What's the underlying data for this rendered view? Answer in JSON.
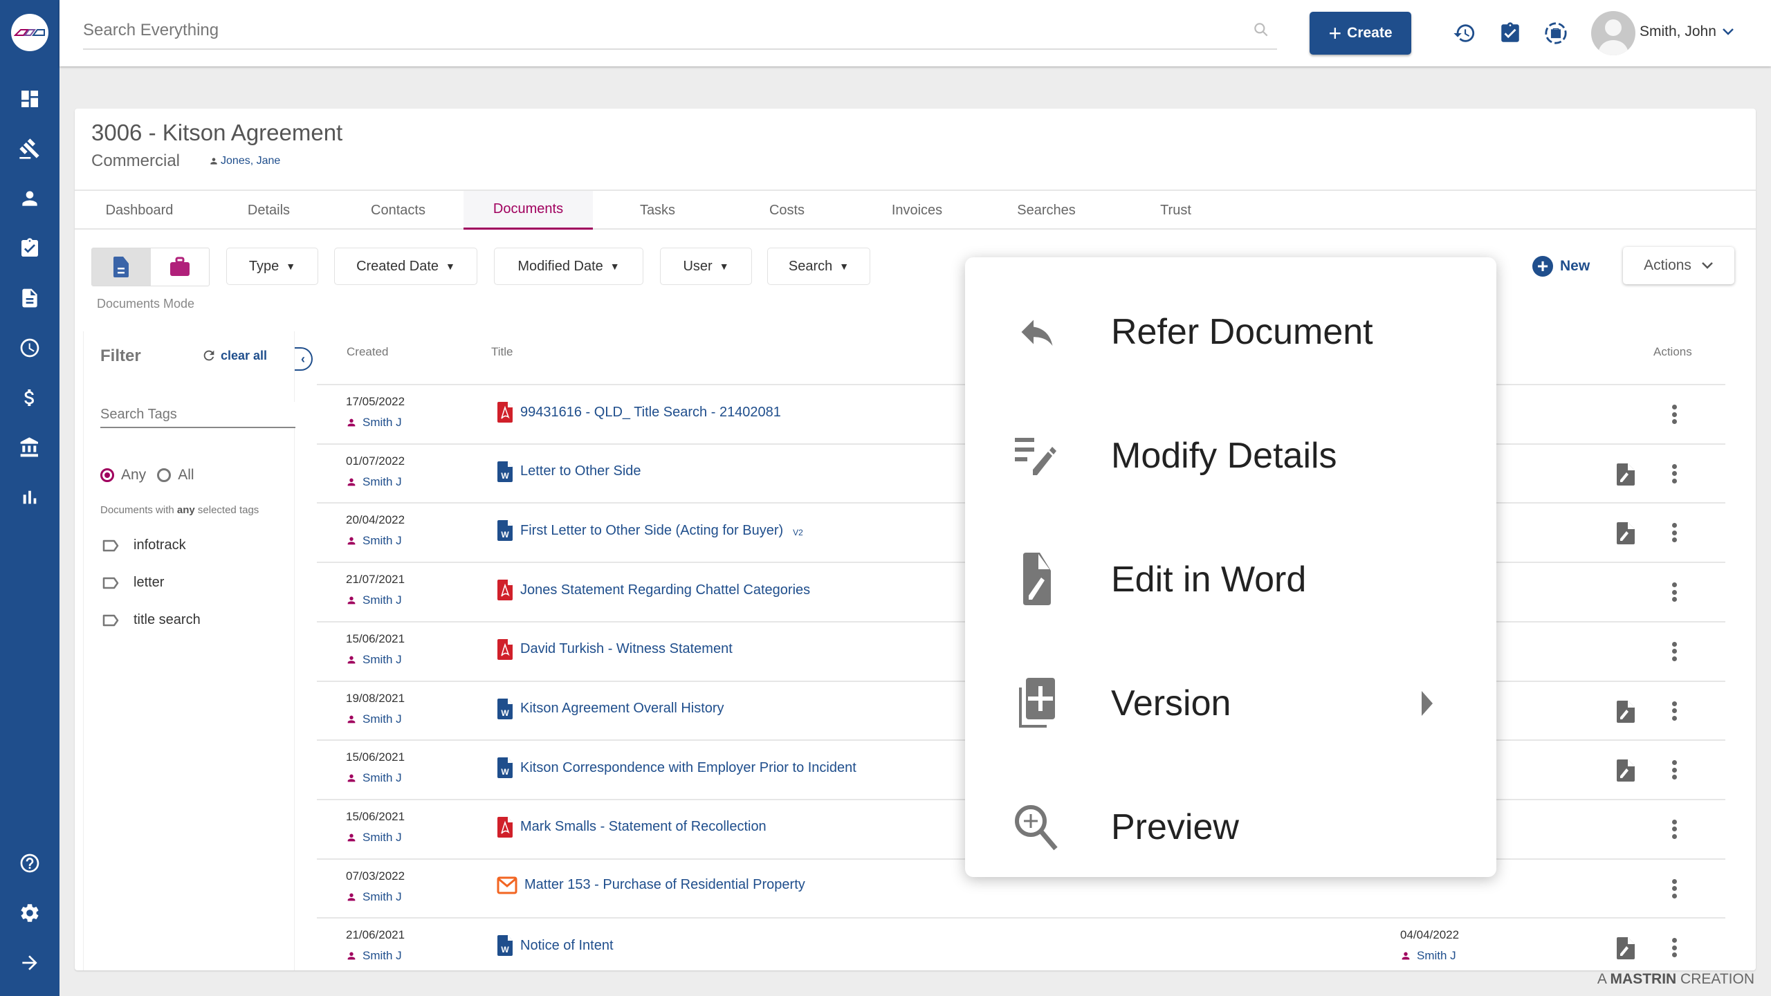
{
  "header": {
    "search_placeholder": "Search Everything",
    "create_label": "Create",
    "user_name": "Smith, John"
  },
  "sidebar": {
    "items": [
      {
        "icon": "dashboard-icon"
      },
      {
        "icon": "gavel-icon"
      },
      {
        "icon": "person-icon"
      },
      {
        "icon": "clipboard-check-icon"
      },
      {
        "icon": "document-icon"
      },
      {
        "icon": "clock-icon"
      },
      {
        "icon": "dollar-icon"
      },
      {
        "icon": "bank-icon"
      },
      {
        "icon": "bar-chart-icon"
      }
    ],
    "bottom": [
      {
        "icon": "help-icon"
      },
      {
        "icon": "settings-icon"
      },
      {
        "icon": "arrow-right-icon"
      }
    ]
  },
  "matter": {
    "title": "3006 - Kitson Agreement",
    "type": "Commercial",
    "owner": "Jones, Jane"
  },
  "tabs": [
    {
      "label": "Dashboard",
      "active": false
    },
    {
      "label": "Details",
      "active": false
    },
    {
      "label": "Contacts",
      "active": false
    },
    {
      "label": "Documents",
      "active": true
    },
    {
      "label": "Tasks",
      "active": false
    },
    {
      "label": "Costs",
      "active": false
    },
    {
      "label": "Invoices",
      "active": false
    },
    {
      "label": "Searches",
      "active": false
    },
    {
      "label": "Trust",
      "active": false
    }
  ],
  "toolbar": {
    "mode_label": "Documents Mode",
    "filters": [
      "Type",
      "Created Date",
      "Modified Date",
      "User",
      "Search"
    ],
    "new_label": "New",
    "actions_label": "Actions"
  },
  "filter_panel": {
    "title": "Filter",
    "clear_label": "clear all",
    "tag_search_placeholder": "Search Tags",
    "radio_any": "Any",
    "radio_all": "All",
    "selected_radio": "Any",
    "help_prefix": "Documents with ",
    "help_bold": "any",
    "help_suffix": " selected tags",
    "tags": [
      "infotrack",
      "letter",
      "title search"
    ]
  },
  "table": {
    "headers": {
      "created": "Created",
      "title": "Title",
      "actions": "Actions"
    },
    "rows": [
      {
        "date": "17/05/2022",
        "user": "Smith J",
        "type": "pdf",
        "title": "99431616 - QLD_ Title Search - 21402081",
        "version": "",
        "edit": false,
        "mod_date": "",
        "mod_user": ""
      },
      {
        "date": "01/07/2022",
        "user": "Smith J",
        "type": "word",
        "title": "Letter to Other Side",
        "version": "",
        "edit": true,
        "mod_date": "",
        "mod_user": ""
      },
      {
        "date": "20/04/2022",
        "user": "Smith J",
        "type": "word",
        "title": "First Letter to Other Side (Acting for Buyer)",
        "version": "V2",
        "edit": true,
        "mod_date": "",
        "mod_user": ""
      },
      {
        "date": "21/07/2021",
        "user": "Smith J",
        "type": "pdf",
        "title": "Jones Statement Regarding Chattel Categories",
        "version": "",
        "edit": false,
        "mod_date": "",
        "mod_user": ""
      },
      {
        "date": "15/06/2021",
        "user": "Smith J",
        "type": "pdf",
        "title": "David Turkish - Witness Statement",
        "version": "",
        "edit": false,
        "mod_date": "",
        "mod_user": ""
      },
      {
        "date": "19/08/2021",
        "user": "Smith J",
        "type": "word",
        "title": "Kitson Agreement Overall History",
        "version": "",
        "edit": true,
        "mod_date": "",
        "mod_user": ""
      },
      {
        "date": "15/06/2021",
        "user": "Smith J",
        "type": "word",
        "title": "Kitson Correspondence with Employer Prior to Incident",
        "version": "",
        "edit": true,
        "mod_date": "",
        "mod_user": ""
      },
      {
        "date": "15/06/2021",
        "user": "Smith J",
        "type": "pdf",
        "title": "Mark Smalls - Statement of Recollection",
        "version": "",
        "edit": false,
        "mod_date": "",
        "mod_user": ""
      },
      {
        "date": "07/03/2022",
        "user": "Smith J",
        "type": "email",
        "title": "Matter 153 - Purchase of Residential Property",
        "version": "",
        "edit": false,
        "mod_date": "",
        "mod_user": ""
      },
      {
        "date": "21/06/2021",
        "user": "Smith J",
        "type": "word",
        "title": "Notice of Intent",
        "version": "",
        "edit": true,
        "mod_date": "04/04/2022",
        "mod_user": "Smith J"
      }
    ]
  },
  "context_menu": {
    "items": [
      {
        "label": "Refer Document",
        "icon": "reply-icon",
        "submenu": false
      },
      {
        "label": "Modify Details",
        "icon": "edit-list-icon",
        "submenu": false
      },
      {
        "label": "Edit in Word",
        "icon": "edit-document-icon",
        "submenu": false
      },
      {
        "label": "Version",
        "icon": "add-version-icon",
        "submenu": true
      },
      {
        "label": "Preview",
        "icon": "zoom-in-icon",
        "submenu": false
      }
    ]
  },
  "footer": {
    "prefix": "A ",
    "brand": "MASTRIN",
    "suffix": " CREATION"
  },
  "colors": {
    "primary": "#1f4e8c",
    "accent": "#a0005e",
    "pdf": "#d0202a",
    "email": "#f26522"
  }
}
